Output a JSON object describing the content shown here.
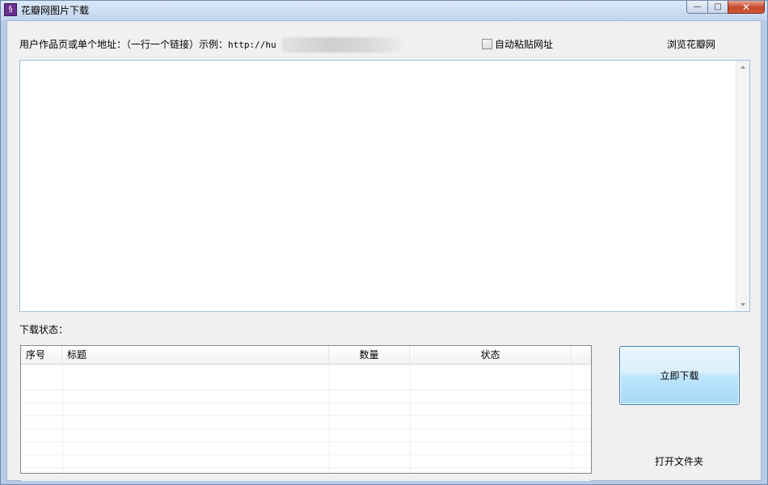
{
  "window": {
    "title": "花瓣网图片下载",
    "app_icon_glyph": "§",
    "controls": {
      "minimize": "—",
      "maximize": "□",
      "close": "✕"
    }
  },
  "form": {
    "url_label": "用户作品页或单个地址：（一行一个链接）示例：",
    "url_example_prefix": "http://hu",
    "auto_paste_label": "自动粘贴网址",
    "auto_paste_checked": false,
    "browse_link": "浏览花瓣网",
    "url_input_value": ""
  },
  "status": {
    "label": "下载状态：",
    "columns": [
      "序号",
      "标题",
      "数量",
      "状态"
    ],
    "rows": []
  },
  "actions": {
    "download_now": "立即下载",
    "open_folder": "打开文件夹"
  }
}
